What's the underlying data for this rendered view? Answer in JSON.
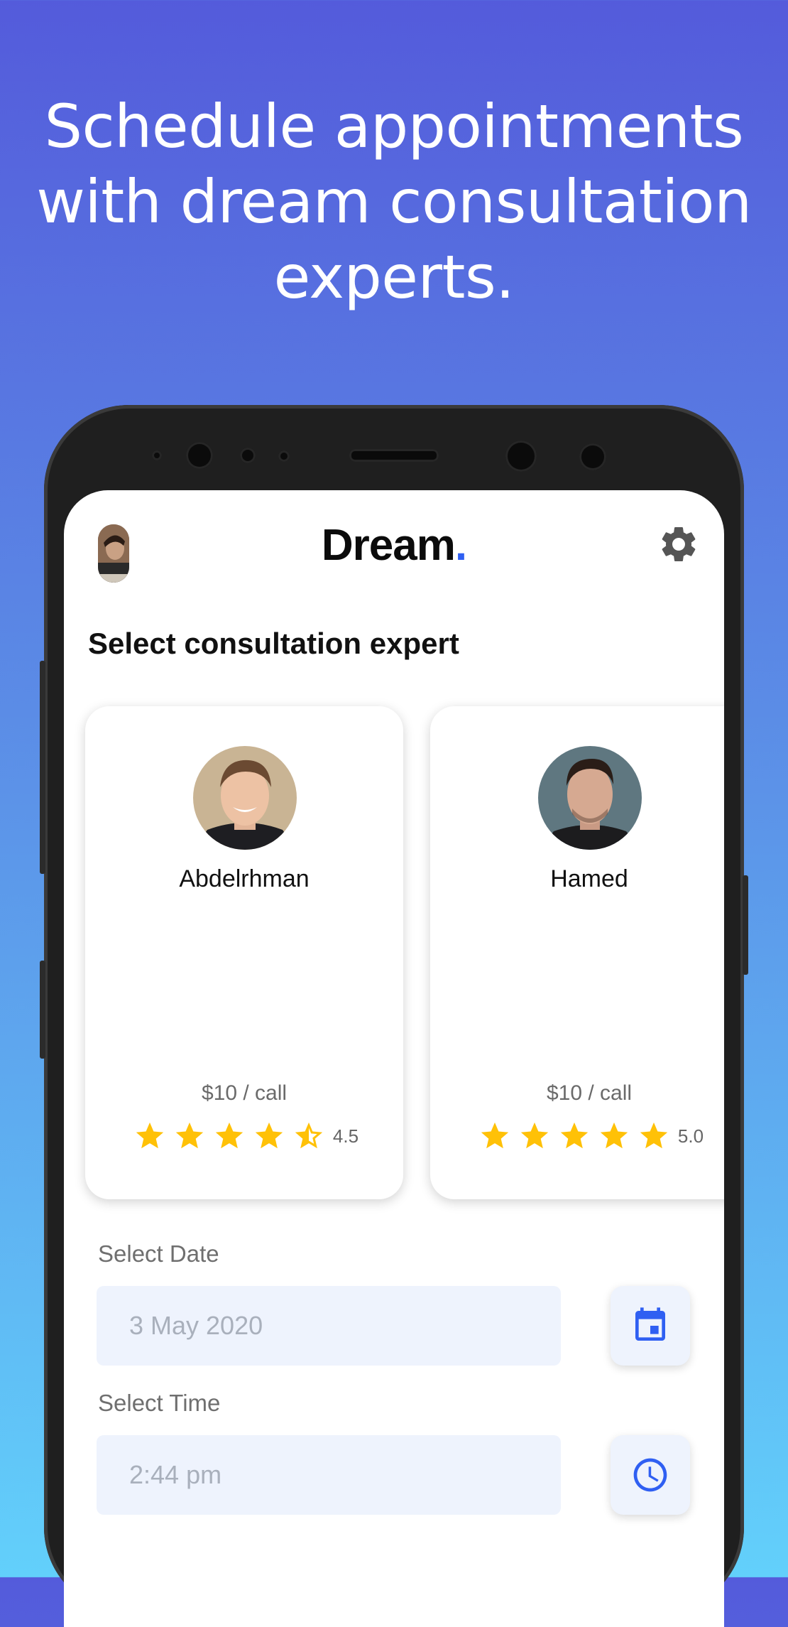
{
  "promo": {
    "headline_line1": "Schedule appointments",
    "headline_line2": "with dream consultation",
    "headline_line3": "experts."
  },
  "app": {
    "brand_name": "Dream",
    "brand_dot": ".",
    "accent_color": "#2f5ff2",
    "settings_icon": "gear-icon"
  },
  "main": {
    "section_title": "Select consultation expert",
    "experts": [
      {
        "name": "Abdelrhman",
        "price": "$10 / call",
        "rating": 4.5,
        "rating_label": "4.5"
      },
      {
        "name": "Hamed",
        "price": "$10 / call",
        "rating": 5.0,
        "rating_label": "5.0"
      }
    ],
    "date": {
      "label": "Select Date",
      "value": "3 May 2020",
      "icon": "calendar-icon"
    },
    "time": {
      "label": "Select Time",
      "value": "2:44 pm",
      "icon": "clock-icon"
    }
  }
}
